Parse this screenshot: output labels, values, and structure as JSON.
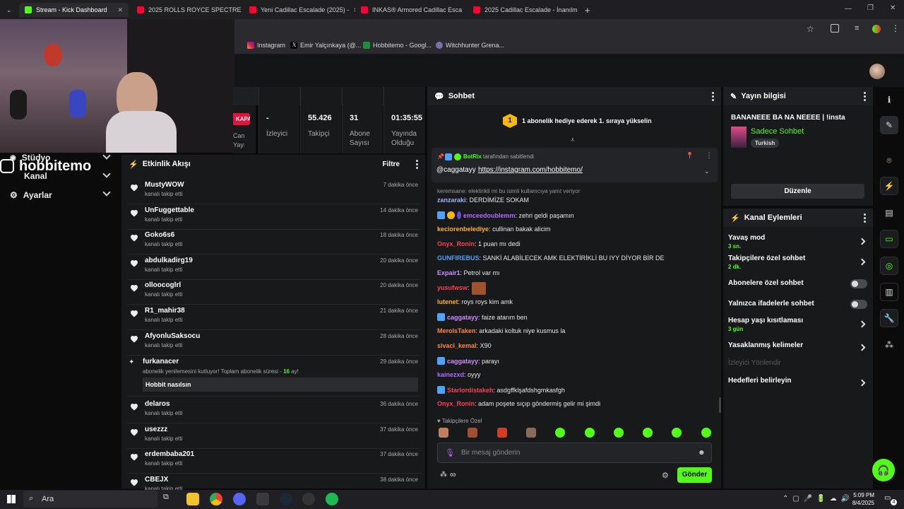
{
  "browser": {
    "tabs": [
      {
        "label": "Stream - Kick Dashboard",
        "color": "#53fc18"
      },
      {
        "label": "2025 ROLLS ROYCE SPECTRE #",
        "color": "#ff0033"
      },
      {
        "label": "Yeni Cadillac Escalade (2025) -",
        "color": "#ff0033"
      },
      {
        "label": "INKAS® Armored Cadillac Esca",
        "color": "#ff0033"
      },
      {
        "label": "2025 Cadillac Escalade - İnanılm",
        "color": "#ff0033"
      }
    ],
    "bookmarks": [
      "Instagram",
      "Emir Yalçınkaya (@...",
      "Hobbitemo - Googl...",
      "Witchhunter Grena..."
    ]
  },
  "streamer": {
    "name": "hobbitemo"
  },
  "nav": [
    "Stüdyo",
    "Kanal",
    "Ayarlar"
  ],
  "stats": {
    "status": "KAPALI",
    "status_sub": "Canlı Yayın",
    "items": [
      {
        "value": "-",
        "label": "İzleyici"
      },
      {
        "value": "55.426",
        "label": "Takipçi"
      },
      {
        "value": "31",
        "label": "Abone Sayısı"
      },
      {
        "value": "01:35:55",
        "label": "Yayında Olduğu Süre"
      }
    ]
  },
  "activity": {
    "title": "Etkinlik Akışı",
    "filter": "Filtre",
    "follow_text": "kanalı takip etti",
    "items": [
      {
        "user": "MustyWOW",
        "time": "7 dakika önce"
      },
      {
        "user": "UnFuggettable",
        "time": "14 dakika önce"
      },
      {
        "user": "Goko6s6",
        "time": "18 dakika önce"
      },
      {
        "user": "abdulkadirg19",
        "time": "20 dakika önce"
      },
      {
        "user": "olloocoglrl",
        "time": "20 dakika önce"
      },
      {
        "user": "R1_mahir38",
        "time": "21 dakika önce"
      },
      {
        "user": "AfyonluSaksocu",
        "time": "28 dakika önce"
      }
    ],
    "resub": {
      "user": "furkanacer",
      "time": "29 dakika önce",
      "text": "abonelik yenilemesini kutluyor! Toplam abonelik süresi -",
      "months": "16",
      "suffix": "ay!",
      "message": "Hobbit nasılsın"
    },
    "items2": [
      {
        "user": "delaros",
        "time": "36 dakika önce"
      },
      {
        "user": "usezzz",
        "time": "37 dakika önce"
      },
      {
        "user": "erdembaba201",
        "time": "37 dakika önce"
      },
      {
        "user": "CBEJX",
        "time": "38 dakika önce"
      }
    ]
  },
  "chat": {
    "title": "Sohbet",
    "gift_banner": "1 abonelik hediye ederek 1. sıraya yükselin",
    "gift_rank": "1",
    "pinned": {
      "by": "BotRix",
      "by_suffix": "tarafından sabitlendi",
      "user": "@caggatayy",
      "link": "https://instagram.com/hobbitemo/"
    },
    "reply_note": "keremsane: elektirikli mi bu isimli kullanıcıya yanıt veriyor",
    "messages": [
      {
        "user": "zanzaraki",
        "color": "#9fb4ff",
        "text": "DERDİMİZE SOKAM"
      },
      {
        "user": "emceedoublemm",
        "color": "#b06cff",
        "text": "zehri geldi paşamın"
      },
      {
        "user": "kecioren​belediye",
        "color": "#ffb02e",
        "text": "cullinan bakak alicim"
      },
      {
        "user": "Onyx_Ronin",
        "color": "#ff3b5c",
        "text": "1 puan mı dedi"
      },
      {
        "user": "GUNFIREBUS",
        "color": "#4fa3ff",
        "text": "SANKİ ALABİLECEK AMK ELEKTİRİKLİ BU IYY DİYOR BİR DE"
      },
      {
        "user": "Expair1",
        "color": "#d08cff",
        "text": "Petrol var mı"
      },
      {
        "user": "yusufwsw",
        "color": "#ff3b5c",
        "text": ""
      },
      {
        "user": "lutenet",
        "color": "#ffb02e",
        "text": "roys roys kim amk"
      },
      {
        "user": "caggatayy",
        "color": "#d08cff",
        "text": "faize atarım ben"
      },
      {
        "user": "MerolsTaken",
        "color": "#ff8a3b",
        "text": "arkadaki koltuk niye kusmus la"
      },
      {
        "user": "sivaci_kemal",
        "color": "#ff8a3b",
        "text": "X90"
      },
      {
        "user": "caggatayy",
        "color": "#d08cff",
        "text": "parayı"
      },
      {
        "user": "kainezxd",
        "color": "#b06cff",
        "text": "oyyy"
      },
      {
        "user": "Starlordistakeh",
        "color": "#ff3b5c",
        "text": "asdgffklşafdshgmkasfgh"
      },
      {
        "user": "Onyx_Ronin",
        "color": "#ff3b5c",
        "text": "adam poşete sıçıp göndermiş gelir mi şimdi"
      }
    ],
    "followers_only": "Takipçilere Özel",
    "input_placeholder": "Bir mesaj gönderin",
    "send": "Gönder",
    "infinity": "∞"
  },
  "info": {
    "title": "Yayın bilgisi",
    "stream_title": "BANANEEE BA NA NEEEE | !insta",
    "category": "Sadece Sohbet",
    "language": "Turkish",
    "edit": "Düzenle"
  },
  "actions": {
    "title": "Kanal Eylemleri",
    "items": [
      {
        "label": "Yavaş mod",
        "sub": "3 sn.",
        "kind": "chev"
      },
      {
        "label": "Takipçilere özel sohbet",
        "sub": "2 dk.",
        "kind": "chev"
      },
      {
        "label": "Abonelere özel sohbet",
        "sub": "",
        "kind": "toggle"
      },
      {
        "label": "Yalnızca ifadelerle sohbet",
        "sub": "",
        "kind": "toggle"
      },
      {
        "label": "Hesap yaşı kısıtlaması",
        "sub": "3 gün",
        "kind": "chev"
      },
      {
        "label": "Yasaklanmış kelimeler",
        "sub": "",
        "kind": "chev"
      },
      {
        "label": "İzleyici Yönlendir",
        "sub": "",
        "kind": "disabled"
      },
      {
        "label": "Hedefleri belirleyin",
        "sub": "",
        "kind": "chev"
      }
    ]
  },
  "taskbar": {
    "search": "Ara",
    "time": "5:09 PM",
    "date": "8/4/2025",
    "notif": "4"
  }
}
